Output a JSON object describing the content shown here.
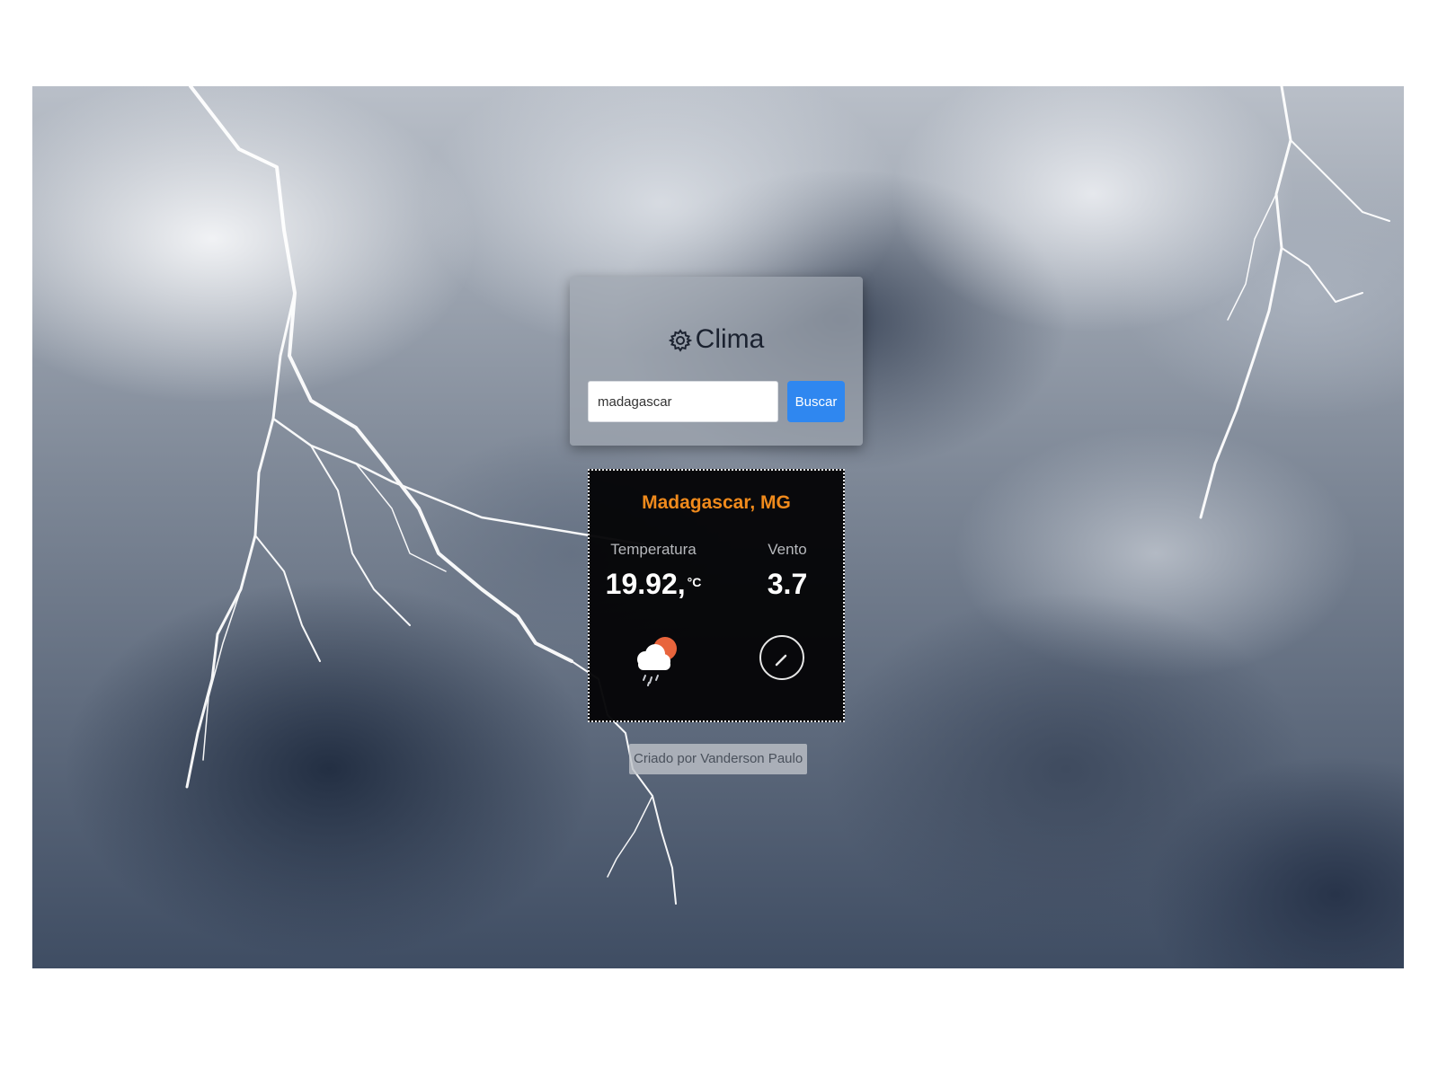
{
  "app": {
    "title": "Clima",
    "title_icon": "gear-icon"
  },
  "search": {
    "value": "madagascar",
    "button_label": "Buscar"
  },
  "weather": {
    "location": "Madagascar, MG",
    "temperature": {
      "label": "Temperatura",
      "value": "19.92,",
      "unit": "°C",
      "icon": "cloud-sun-rain-icon"
    },
    "wind": {
      "label": "Vento",
      "value": "3.7",
      "icon": "wind-direction-icon"
    }
  },
  "footer": {
    "credit": "Criado por Vanderson Paulo"
  },
  "colors": {
    "accent": "#2f87f0",
    "location": "#f08a1c",
    "card_bg": "#040406"
  }
}
